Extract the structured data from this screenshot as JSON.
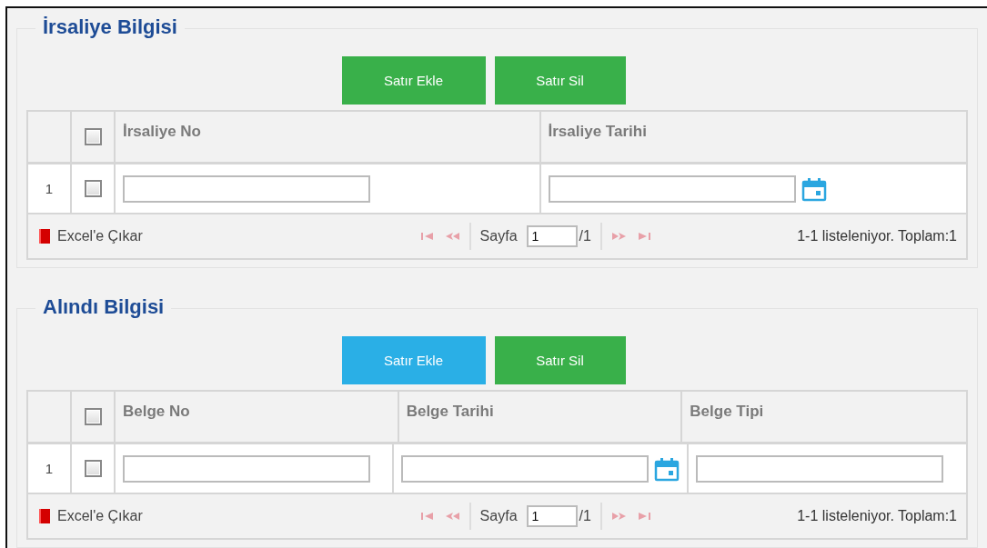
{
  "sections": [
    {
      "title": "İrsaliye Bilgisi",
      "buttons": [
        {
          "label": "Satır Ekle",
          "highlighted": false
        },
        {
          "label": "Satır Sil",
          "highlighted": false
        }
      ],
      "header_checked": false,
      "columns": [
        {
          "label": "İrsaliye No"
        },
        {
          "label": "İrsaliye Tarihi"
        }
      ],
      "rows": [
        {
          "number": "1",
          "checked": false,
          "cells": [
            {
              "kind": "text"
            },
            {
              "kind": "date"
            }
          ]
        }
      ],
      "footer": {
        "export_label": "Excel'e Çıkar",
        "page_label": "Sayfa",
        "page_value": "1",
        "page_total": "/1",
        "summary": "1-1 listeleniyor. Toplam:1"
      }
    },
    {
      "title": "Alındı Bilgisi",
      "buttons": [
        {
          "label": "Satır Ekle",
          "highlighted": true
        },
        {
          "label": "Satır Sil",
          "highlighted": false
        }
      ],
      "header_checked": false,
      "columns": [
        {
          "label": "Belge No"
        },
        {
          "label": "Belge Tarihi"
        },
        {
          "label": "Belge Tipi"
        }
      ],
      "rows": [
        {
          "number": "1",
          "checked": false,
          "cells": [
            {
              "kind": "text"
            },
            {
              "kind": "date"
            },
            {
              "kind": "text"
            }
          ]
        }
      ],
      "footer": {
        "export_label": "Excel'e Çıkar",
        "page_label": "Sayfa",
        "page_value": "1",
        "page_total": "/1",
        "summary": "1-1 listeleniyor. Toplam:1"
      }
    }
  ]
}
